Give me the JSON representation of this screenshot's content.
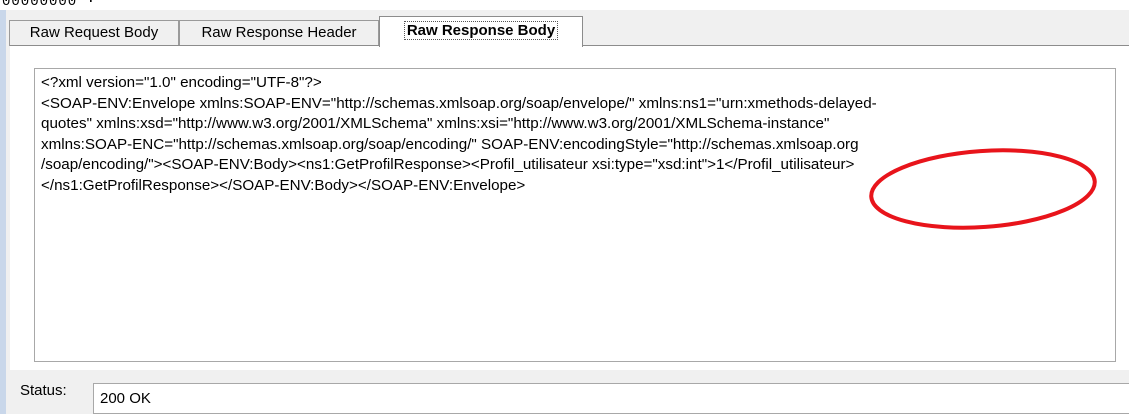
{
  "top_fragment": "00000000 ·",
  "tabs": [
    {
      "label": "Raw Request Body",
      "active": false
    },
    {
      "label": "Raw Response Header",
      "active": false
    },
    {
      "label": "Raw Response Body",
      "active": true
    }
  ],
  "response_body": {
    "lines": [
      "<?xml version=\"1.0\" encoding=\"UTF-8\"?>",
      "<SOAP-ENV:Envelope xmlns:SOAP-ENV=\"http://schemas.xmlsoap.org/soap/envelope/\" xmlns:ns1=\"urn:xmethods-delayed-",
      "quotes\" xmlns:xsd=\"http://www.w3.org/2001/XMLSchema\" xmlns:xsi=\"http://www.w3.org/2001/XMLSchema-instance\"",
      "xmlns:SOAP-ENC=\"http://schemas.xmlsoap.org/soap/encoding/\" SOAP-ENV:encodingStyle=\"http://schemas.xmlsoap.org",
      "/soap/encoding/\"><SOAP-ENV:Body><ns1:GetProfilResponse><Profil_utilisateur xsi:type=\"xsd:int\">1</Profil_utilisateur>",
      "</ns1:GetProfilResponse></SOAP-ENV:Body></SOAP-ENV:Envelope>"
    ]
  },
  "annotation": {
    "color": "#e8141b"
  },
  "status": {
    "label": "Status:",
    "value": "200 OK"
  }
}
